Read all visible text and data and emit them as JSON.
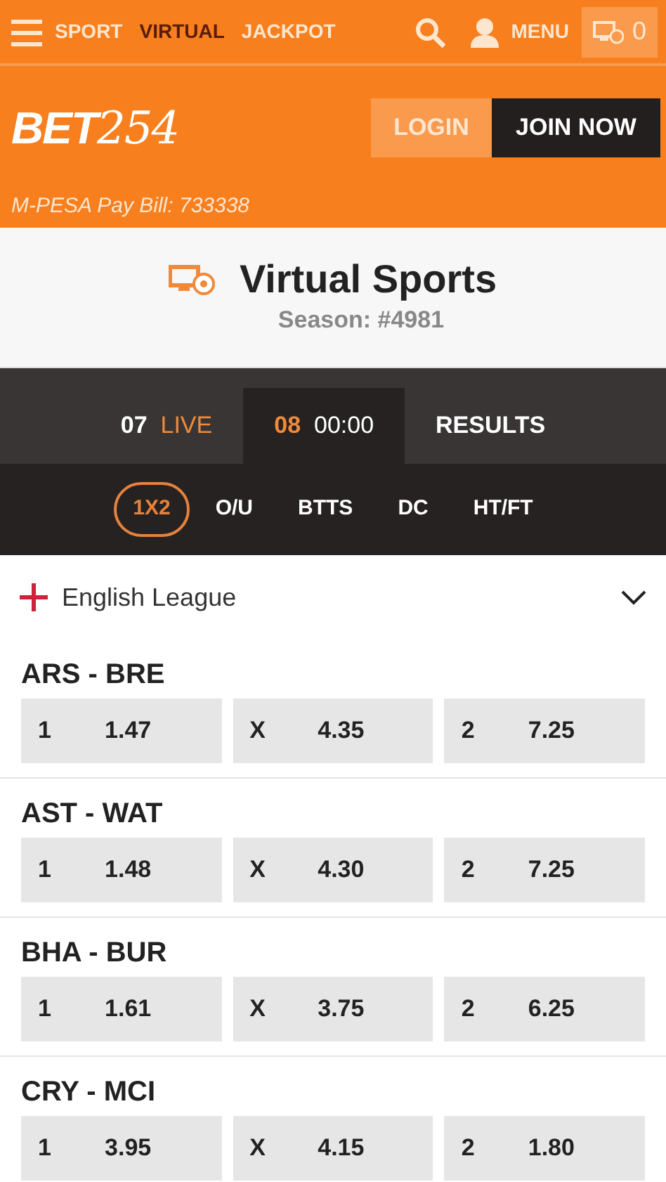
{
  "top_nav": {
    "links": [
      {
        "label": "SPORT",
        "selected": false
      },
      {
        "label": "VIRTUAL",
        "selected": true
      },
      {
        "label": "JACKPOT",
        "selected": false
      }
    ],
    "menu_label": "MENU",
    "betslip_count": "0"
  },
  "header": {
    "logo": {
      "part_1": "BET",
      "part_2": "254"
    },
    "buttons": [
      {
        "label": "LOGIN",
        "kind": "login"
      },
      {
        "label": "JOIN NOW",
        "kind": "join"
      }
    ],
    "paybill": "M-PESA Pay Bill: 733338"
  },
  "title": {
    "heading": "Virtual Sports",
    "season": "Season: #4981"
  },
  "round_tabs": [
    {
      "number": "07",
      "label": "LIVE",
      "selected": false
    },
    {
      "number": "08",
      "label": "00:00",
      "selected": true
    },
    {
      "label": "RESULTS",
      "selected": false
    }
  ],
  "market_tabs": [
    {
      "label": "1X2",
      "selected": true
    },
    {
      "label": "O/U",
      "selected": false
    },
    {
      "label": "BTTS",
      "selected": false
    },
    {
      "label": "DC",
      "selected": false
    },
    {
      "label": "HT/FT",
      "selected": false
    }
  ],
  "league": {
    "name": "English League",
    "expanded": true
  },
  "matches": [
    {
      "teams": "ARS - BRE",
      "odds": [
        {
          "label": "1",
          "value": "1.47"
        },
        {
          "label": "X",
          "value": "4.35"
        },
        {
          "label": "2",
          "value": "7.25"
        }
      ]
    },
    {
      "teams": "AST - WAT",
      "odds": [
        {
          "label": "1",
          "value": "1.48"
        },
        {
          "label": "X",
          "value": "4.30"
        },
        {
          "label": "2",
          "value": "7.25"
        }
      ]
    },
    {
      "teams": "BHA - BUR",
      "odds": [
        {
          "label": "1",
          "value": "1.61"
        },
        {
          "label": "X",
          "value": "3.75"
        },
        {
          "label": "2",
          "value": "6.25"
        }
      ]
    },
    {
      "teams": "CRY - MCI",
      "odds": [
        {
          "label": "1",
          "value": "3.95"
        },
        {
          "label": "X",
          "value": "4.15"
        },
        {
          "label": "2",
          "value": "1.80"
        }
      ]
    }
  ]
}
